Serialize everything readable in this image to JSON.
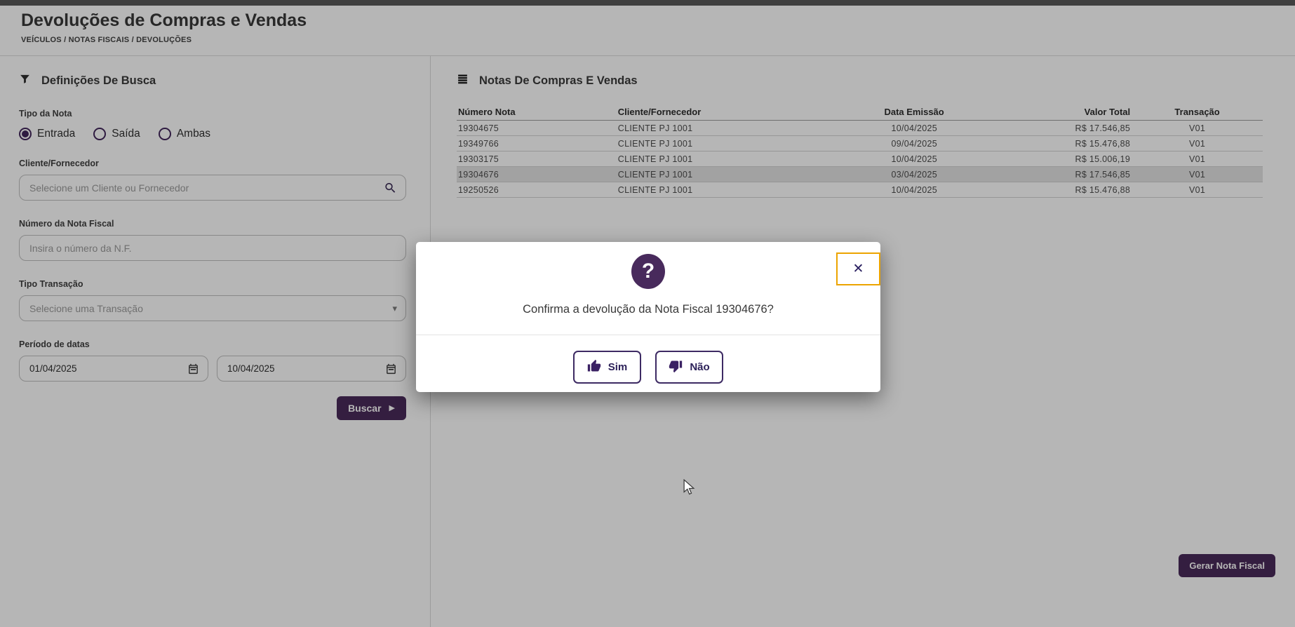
{
  "page": {
    "title": "Devoluções de Compras e Vendas",
    "breadcrumb": "VEÍCULOS / NOTAS FISCAIS / DEVOLUÇÕES"
  },
  "filters": {
    "section_title": "Definições De Busca",
    "tipo_nota": {
      "label": "Tipo da Nota",
      "options": [
        {
          "label": "Entrada",
          "selected": true
        },
        {
          "label": "Saída",
          "selected": false
        },
        {
          "label": "Ambas",
          "selected": false
        }
      ]
    },
    "cliente": {
      "label": "Cliente/Fornecedor",
      "placeholder": "Selecione um Cliente ou Fornecedor"
    },
    "numero_nf": {
      "label": "Número da Nota Fiscal",
      "placeholder": "Insira o número da N.F."
    },
    "transacao": {
      "label": "Tipo Transação",
      "placeholder": "Selecione uma Transação"
    },
    "periodo": {
      "label": "Período de datas",
      "start": "01/04/2025",
      "end": "10/04/2025"
    },
    "buscar_label": "Buscar"
  },
  "table": {
    "section_title": "Notas De Compras E Vendas",
    "columns": [
      "Número Nota",
      "Cliente/Fornecedor",
      "Data Emissão",
      "Valor Total",
      "Transação"
    ],
    "rows": [
      {
        "numero": "19304675",
        "cliente": "CLIENTE PJ 1001",
        "data": "10/04/2025",
        "valor": "R$ 17.546,85",
        "transacao": "V01",
        "selected": false
      },
      {
        "numero": "19349766",
        "cliente": "CLIENTE PJ 1001",
        "data": "09/04/2025",
        "valor": "R$ 15.476,88",
        "transacao": "V01",
        "selected": false
      },
      {
        "numero": "19303175",
        "cliente": "CLIENTE PJ 1001",
        "data": "10/04/2025",
        "valor": "R$ 15.006,19",
        "transacao": "V01",
        "selected": false
      },
      {
        "numero": "19304676",
        "cliente": "CLIENTE PJ 1001",
        "data": "03/04/2025",
        "valor": "R$ 17.546,85",
        "transacao": "V01",
        "selected": true
      },
      {
        "numero": "19250526",
        "cliente": "CLIENTE PJ 1001",
        "data": "10/04/2025",
        "valor": "R$ 15.476,88",
        "transacao": "V01",
        "selected": false
      }
    ]
  },
  "actions": {
    "gerar_label": "Gerar Nota Fiscal"
  },
  "modal": {
    "message": "Confirma a devolução da Nota Fiscal 19304676?",
    "yes_label": "Sim",
    "no_label": "Não"
  },
  "icons": {
    "play_glyph": "▶",
    "caret_glyph": "▾",
    "close_glyph": "✕",
    "question_glyph": "?"
  },
  "colors": {
    "primary_purple": "#4a2a5a",
    "modal_icon_purple": "#482a5c",
    "close_border_orange": "#eca400",
    "selected_row_bg": "#e4e4e4",
    "overlay": "rgba(0,0,0,0.285)"
  }
}
